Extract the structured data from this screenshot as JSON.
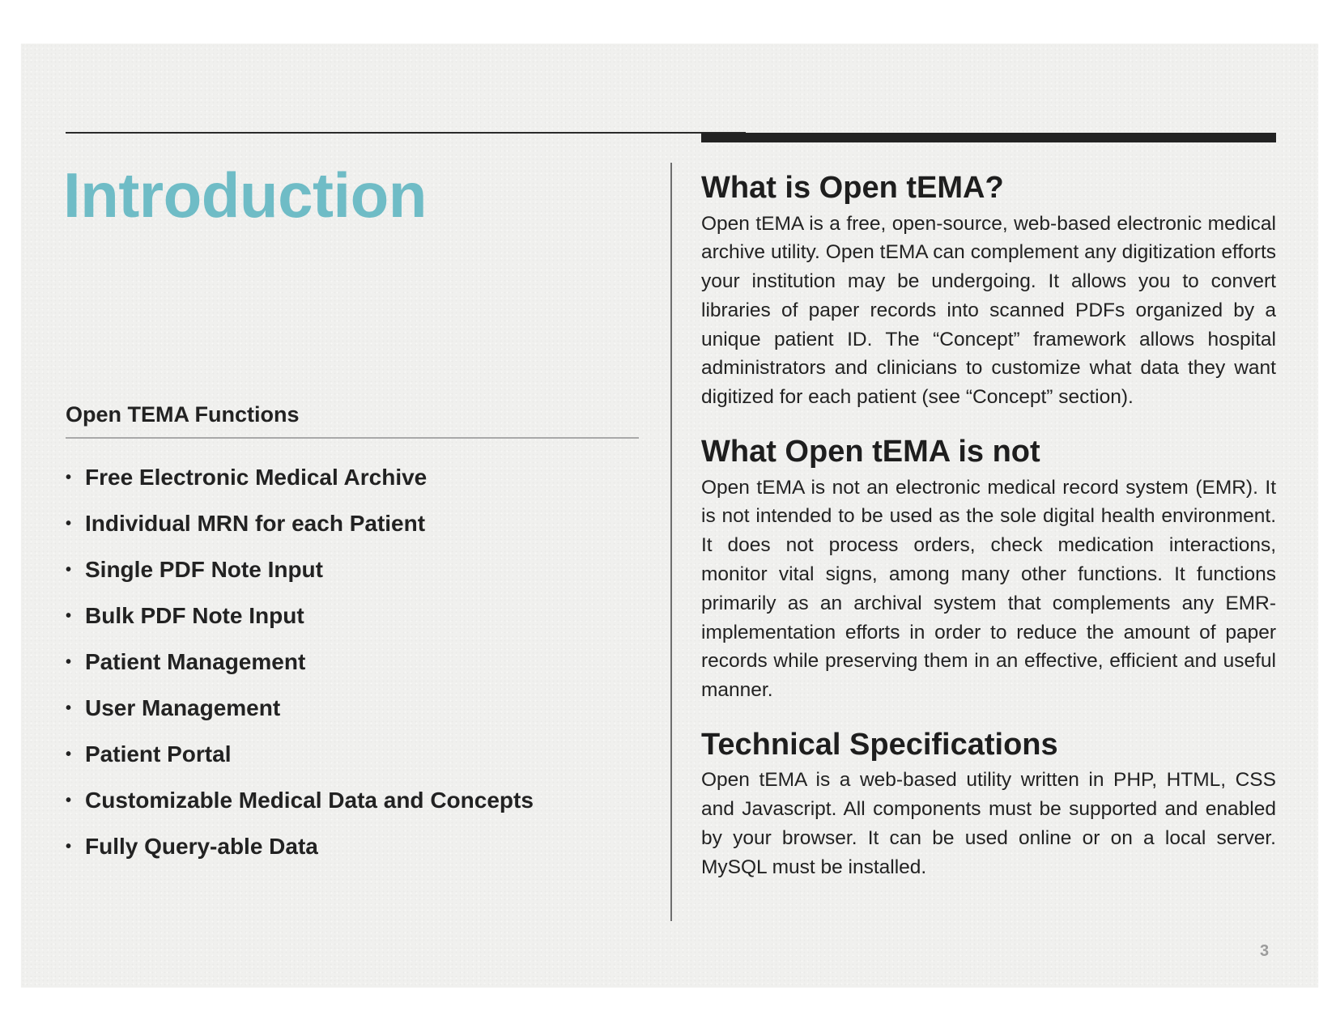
{
  "left": {
    "title": "Introduction",
    "functions_heading": "Open TEMA Functions",
    "bullet": "•",
    "functions": [
      "Free Electronic Medical Archive",
      "Individual MRN for each Patient",
      "Single PDF Note Input",
      "Bulk PDF Note Input",
      "Patient Management",
      "User Management",
      "Patient Portal",
      "Customizable Medical Data and Concepts",
      "Fully Query-able Data"
    ]
  },
  "right": {
    "sections": [
      {
        "heading": "What is Open tEMA?",
        "body": "Open tEMA is a free, open-source, web-based electronic medi­cal archive utility. Open tEMA can complement any digitization efforts your institution may be undergoing. It allows you to con­vert libraries of paper records into scanned PDFs organized by a unique patient ID. The “Concept” framework allows hospital administrators and clinicians to customize what data they want digitized for each patient (see “Concept” section)."
      },
      {
        "heading": "What Open tEMA is not",
        "body": "Open tEMA is not an electronic medical record system (EMR). It is not intended to be used as the sole digital health environ­ment. It does not process orders, check medication interac­tions, monitor vital signs, among many other functions. It func­tions primarily as an archival system that complements any EMR-implementation efforts in order to reduce the amount of paper records while preserving them in an effective, efficient and useful manner."
      },
      {
        "heading": "Technical Specifications",
        "body": "Open tEMA is a web-based utility written in PHP, HTML, CSS and Javascript. All components must be supported and enabled by your browser. It can be used online or on a local server. MySQL must be installed."
      }
    ]
  },
  "footer": {
    "page_number": "3"
  },
  "colors": {
    "title_accent": "#6fbcc6",
    "text": "#222222",
    "page_number": "#9c9c9c"
  }
}
